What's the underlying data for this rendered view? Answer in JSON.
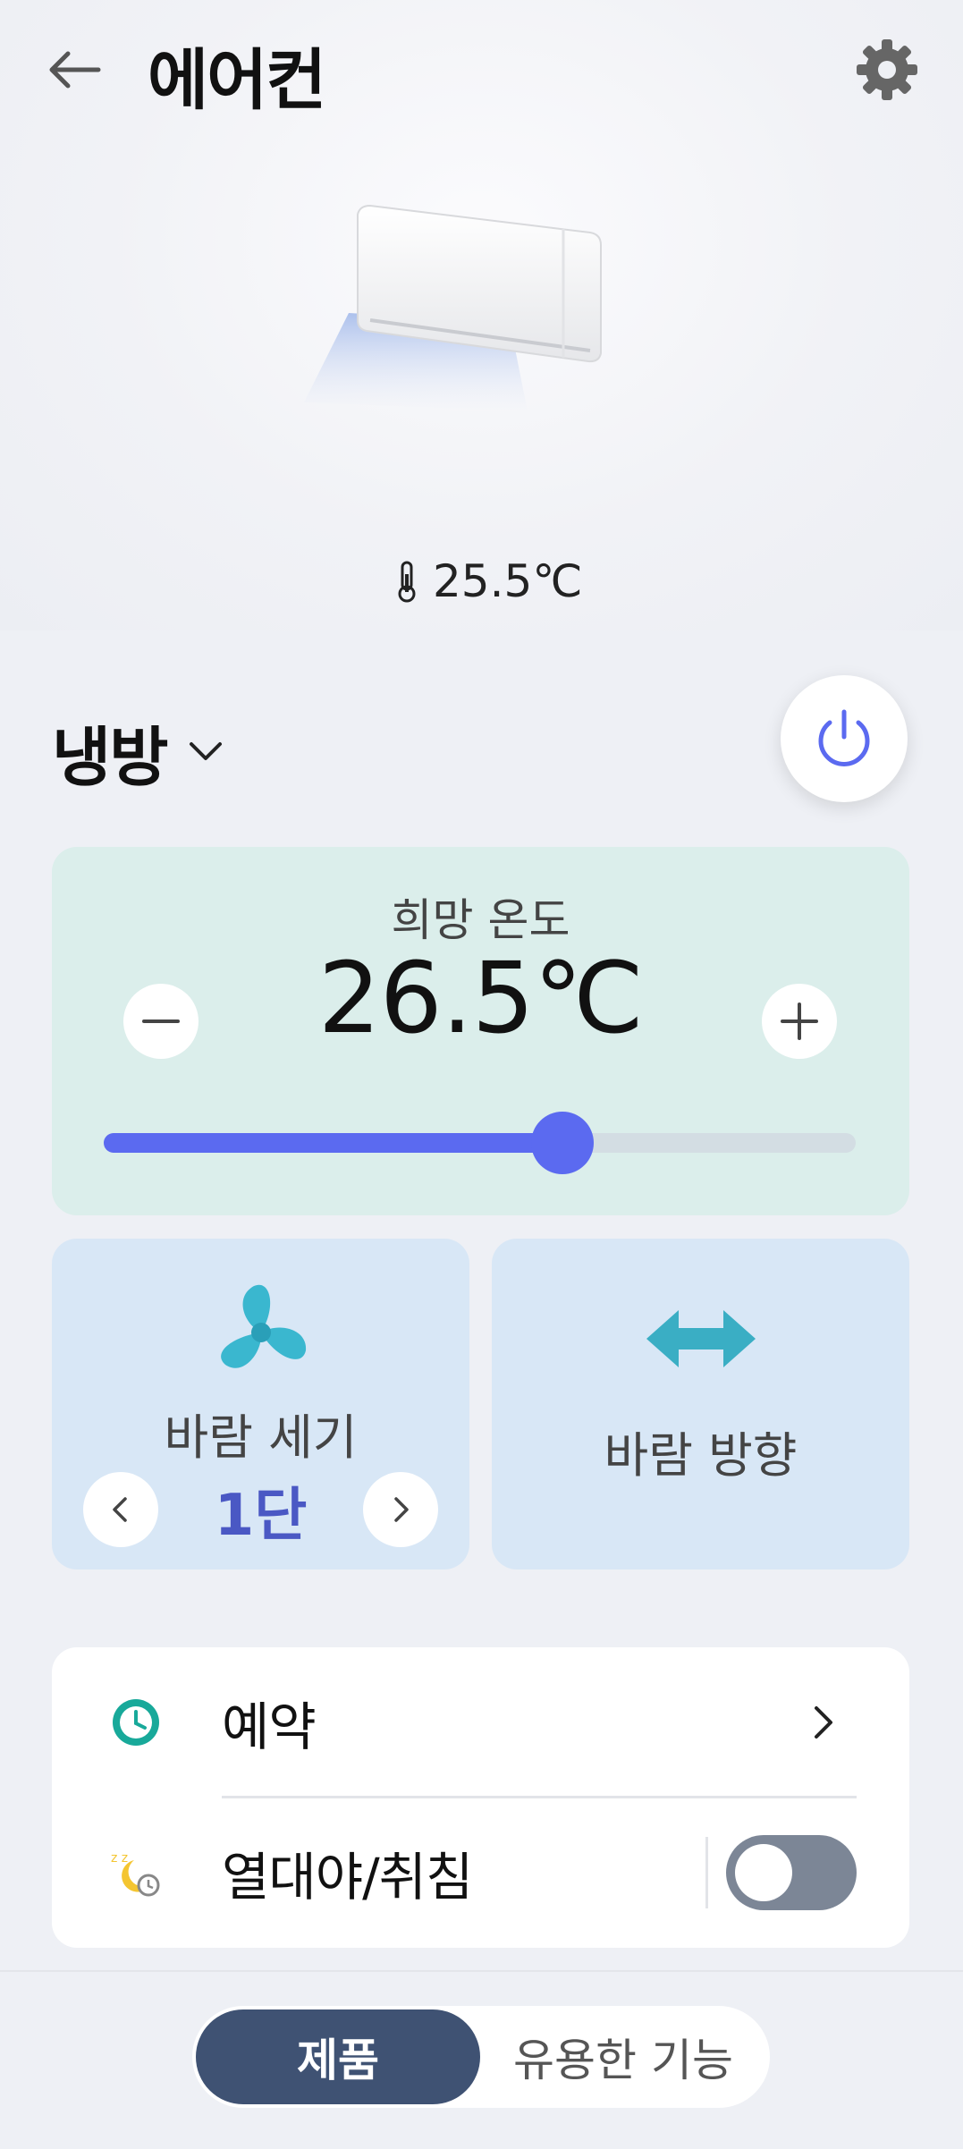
{
  "header": {
    "title": "에어컨",
    "back_icon": "arrow-left-icon",
    "settings_icon": "gear-icon"
  },
  "room": {
    "current_temp": "25.5℃",
    "icon": "thermometer-icon"
  },
  "mode": {
    "label": "냉방",
    "icon": "chevron-down-icon"
  },
  "power": {
    "icon": "power-icon",
    "accent": "#5b6af0"
  },
  "target_temp": {
    "title": "희망 온도",
    "value": "26.5℃",
    "slider_fraction": 0.61
  },
  "wind_speed": {
    "label": "바람 세기",
    "level": "1단",
    "icon": "fan-icon"
  },
  "wind_direction": {
    "label": "바람 방향",
    "icon": "double-arrow-icon"
  },
  "options": [
    {
      "label": "예약",
      "icon": "clock-icon"
    },
    {
      "label": "열대야/취침",
      "icon": "sleep-moon-icon",
      "toggle_on": false
    }
  ],
  "bottom_tabs": {
    "active": "제품",
    "inactive": "유용한 기능"
  },
  "colors": {
    "accent": "#5b6af0",
    "tab_active": "#3f5273",
    "fan": "#3ab7cf"
  }
}
